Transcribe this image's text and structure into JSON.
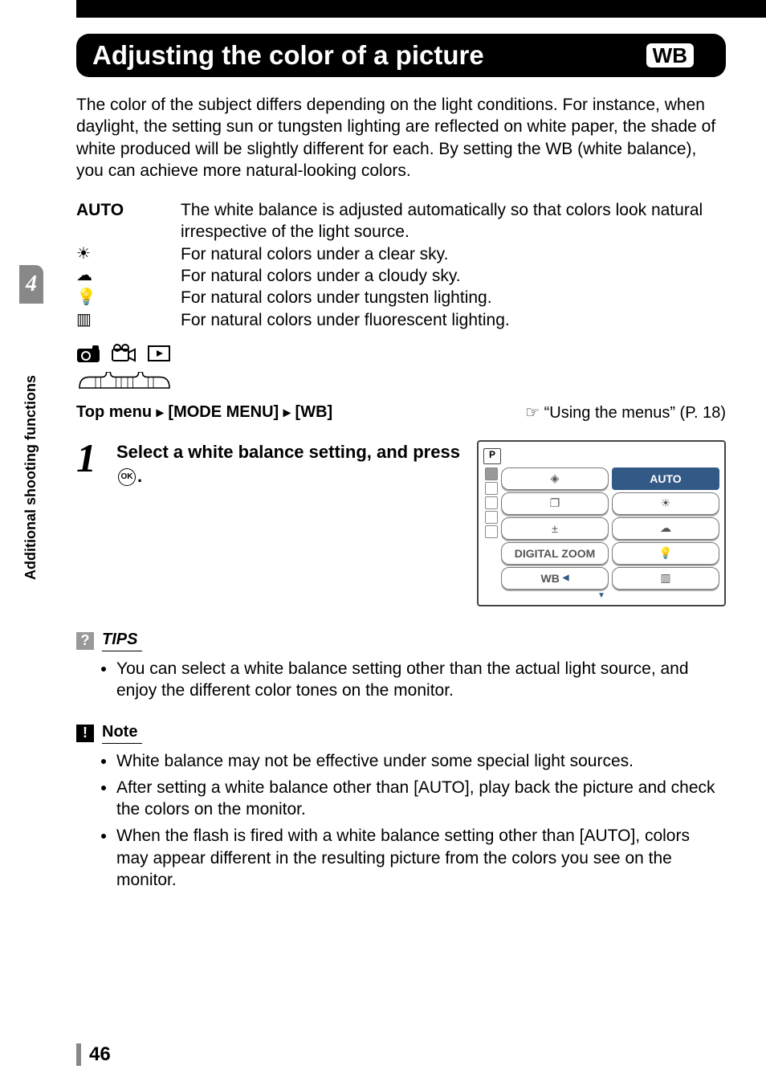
{
  "sidebar": {
    "chapter_number": "4",
    "chapter_title": "Additional shooting functions"
  },
  "title": "Adjusting the color of a picture",
  "title_icon_text": "WB",
  "intro": "The color of the subject differs depending on the light conditions. For instance, when daylight, the setting sun or tungsten lighting are reflected on white paper, the shade of white produced will be slightly different for each. By setting the WB (white balance), you can achieve more natural-looking colors.",
  "options": [
    {
      "key": "AUTO",
      "desc": "The white balance is adjusted automatically so that colors look natural irrespective of the light source.",
      "is_text": true
    },
    {
      "key": "☀",
      "desc": "For natural colors under a clear sky.",
      "is_text": false
    },
    {
      "key": "☁",
      "desc": "For natural colors under a cloudy sky.",
      "is_text": false
    },
    {
      "key": "💡",
      "desc": "For natural colors under tungsten lighting.",
      "is_text": false
    },
    {
      "key": "▥",
      "desc": "For natural colors under fluorescent lighting.",
      "is_text": false
    }
  ],
  "menu_path": {
    "prefix": "Top menu ",
    "seg1": "[MODE MENU]",
    "seg2": "[WB]"
  },
  "reference": "“Using the menus” (P. 18)",
  "step": {
    "number": "1",
    "text_before": "Select a white balance setting, and press ",
    "ok_label": "OK",
    "text_after": "."
  },
  "menu_screenshot": {
    "mode_badge": "P",
    "left_items": [
      "◈",
      "❐",
      "±",
      "DIGITAL ZOOM",
      "WB"
    ],
    "right_items": [
      "AUTO",
      "☀",
      "☁",
      "💡",
      "▥"
    ]
  },
  "tips": {
    "heading": "TIPS",
    "items": [
      "You can select a white balance setting other than the actual light source, and enjoy the different color tones on the monitor."
    ]
  },
  "note": {
    "heading": "Note",
    "items": [
      "White balance may not be effective under some special light sources.",
      "After setting a white balance other than [AUTO], play back the picture and check the colors on the monitor.",
      "When the flash is fired with a white balance setting other than [AUTO], colors may appear different in the resulting picture from the colors you see on the monitor."
    ]
  },
  "page_number": "46"
}
